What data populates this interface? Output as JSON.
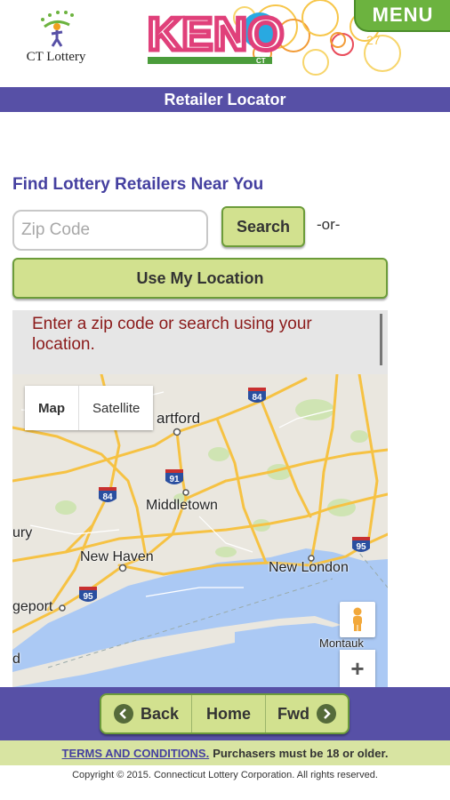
{
  "header": {
    "logo_text": "CT Lottery",
    "keno_logo_text": "KENO",
    "keno_logo_sub": "CT",
    "menu_label": "MENU"
  },
  "page_title": "Retailer Locator",
  "locator": {
    "heading": "Find Lottery Retailers Near You",
    "zip_placeholder": "Zip Code",
    "zip_value": "",
    "search_label": "Search",
    "or_text": "-or-",
    "use_location_label": "Use My Location",
    "message": "Enter a zip code or search using your location."
  },
  "map": {
    "type_map": "Map",
    "type_satellite": "Satellite",
    "zoom_in": "+",
    "places": [
      "artford",
      "Middletown",
      "New Haven",
      "New London",
      "Montauk",
      "ury",
      "geport",
      "d"
    ],
    "route_shields": [
      "84",
      "91",
      "84",
      "95",
      "95"
    ]
  },
  "nav": {
    "back": "Back",
    "home": "Home",
    "fwd": "Fwd"
  },
  "footer": {
    "terms_link": "TERMS AND CONDITIONS.",
    "terms_text": "Purchasers must be 18 or older.",
    "copyright": "Copyright © 2015. Connecticut Lottery Corporation. All rights reserved."
  },
  "colors": {
    "brand_purple": "#5750a6",
    "button_green": "#d2e18f",
    "menu_green": "#6cb33f",
    "message_red": "#8b1a1a"
  }
}
